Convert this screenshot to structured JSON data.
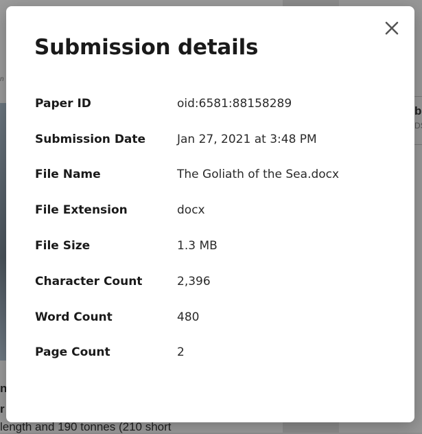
{
  "background": {
    "snippet_n": "n",
    "word_1": "n",
    "word_2": "r",
    "sentence": "length and 190 tonnes (210 short",
    "right_b": "b",
    "right_d": "DS"
  },
  "modal": {
    "title": "Submission details",
    "close_label": "×",
    "rows": [
      {
        "label": "Paper ID",
        "value": "oid:6581:88158289"
      },
      {
        "label": "Submission Date",
        "value": "Jan 27, 2021 at 3:48 PM"
      },
      {
        "label": "File Name",
        "value": "The Goliath of the Sea.docx"
      },
      {
        "label": "File Extension",
        "value": "docx"
      },
      {
        "label": "File Size",
        "value": "1.3 MB"
      },
      {
        "label": "Character Count",
        "value": "2,396"
      },
      {
        "label": "Word Count",
        "value": "480"
      },
      {
        "label": "Page Count",
        "value": "2"
      }
    ]
  },
  "icons": {
    "close": "close-icon"
  },
  "colors": {
    "overlay": "#9b9b9b",
    "modal_bg": "#ffffff",
    "text_primary": "#1a1a1a",
    "close_icon": "#555555"
  }
}
